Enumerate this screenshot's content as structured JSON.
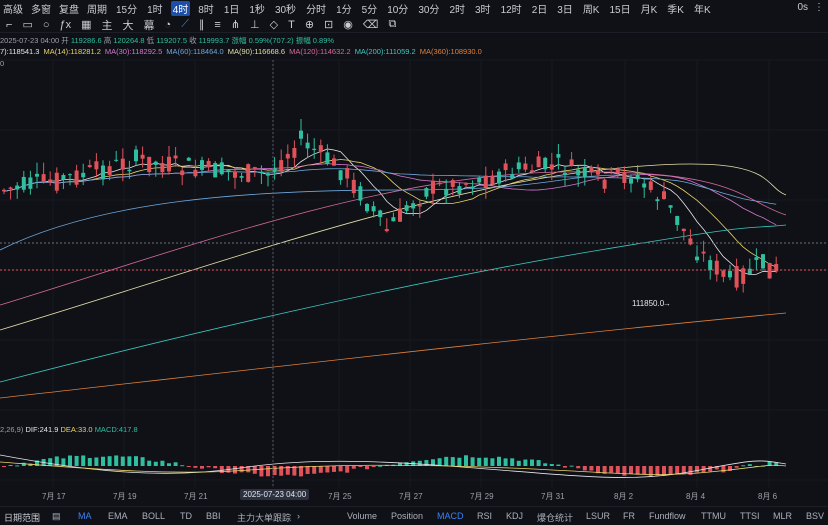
{
  "toolbar": {
    "items": [
      "高级",
      "多窗",
      "复盘",
      "周期"
    ],
    "timeframes": [
      "15分",
      "1时",
      "4时",
      "8时",
      "1日",
      "1秒",
      "30秒",
      "分时",
      "1分",
      "5分",
      "10分",
      "30分",
      "2时",
      "3时",
      "12时",
      "2日",
      "3日",
      "周K",
      "15日",
      "月K",
      "季K",
      "年K"
    ],
    "active_timeframe": "4时",
    "right_value": "0s"
  },
  "drawing_tools": {
    "labels": [
      "主",
      "大",
      "幕"
    ]
  },
  "ohlc_info": {
    "time": "2025-07-23 04:00",
    "open": "119286.6",
    "high": "120264.8",
    "low": "119207.5",
    "close": "119993.7",
    "change": "涨幅 0.59%(707.2)",
    "amplitude": "振幅 0.89%"
  },
  "ma_legend": [
    {
      "label": "7):118541.3",
      "color": "#e5e7eb"
    },
    {
      "label": "MA(14):118281.2",
      "color": "#e9d36a"
    },
    {
      "label": "MA(30):118292.5",
      "color": "#d478d0"
    },
    {
      "label": "MA(60):118464.0",
      "color": "#6fa8dc"
    },
    {
      "label": "MA(90):116668.6",
      "color": "#e5dfa8"
    },
    {
      "label": "MA(120):114632.2",
      "color": "#d86aa0"
    },
    {
      "label": "MA(200):111059.2",
      "color": "#3cc8c0"
    },
    {
      "label": "MA(360):108930.0",
      "color": "#e0803a"
    }
  ],
  "y_label_top": "0",
  "low_marker": "111850.0",
  "macd_legend": {
    "params": "2,26,9)",
    "dif": "DIF:241.9",
    "dea": "DEA:33.0",
    "macd": "MACD:417.8"
  },
  "x_axis": [
    "7月 17",
    "7月 19",
    "7月 21",
    "2025-07-23 04:00",
    "7月 25",
    "7月 27",
    "7月 29",
    "7月 31",
    "8月 2",
    "8月 4",
    "8月 6"
  ],
  "bottom_bar": {
    "left": "日期范围",
    "indicators_main": [
      "MA",
      "EMA",
      "BOLL",
      "TD",
      "BBI",
      "主力大单跟踪"
    ],
    "indicators_sub": [
      "Volume",
      "Position",
      "MACD",
      "RSI",
      "KDJ",
      "爆仓统计",
      "LSUR",
      "FR",
      "Fundflow",
      "TTMU",
      "TTSI",
      "MLR",
      "BSV"
    ],
    "active_main": "MA",
    "active_sub": "MACD"
  },
  "colors": {
    "up": "#2fbfa0",
    "down": "#e0525a",
    "accent": "#3b82f6"
  }
}
